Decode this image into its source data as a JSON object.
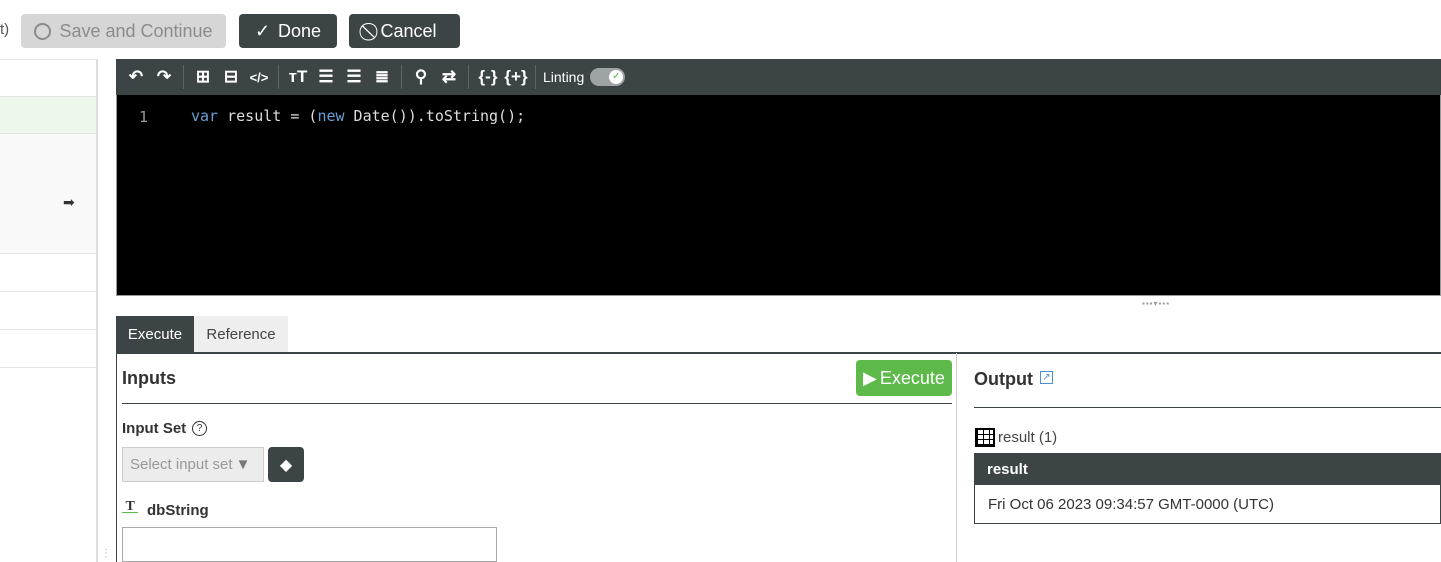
{
  "top": {
    "fragment": "t)",
    "save_label": "Save and Continue",
    "done_label": "Done",
    "cancel_label": "Cancel"
  },
  "editor": {
    "linting_label": "Linting",
    "line_number": "1",
    "code": {
      "kw1": "var",
      "p1": " result = (",
      "kw2": "new",
      "p2": " Date()).toString();"
    }
  },
  "tabs": [
    {
      "label": "Execute"
    },
    {
      "label": "Reference"
    }
  ],
  "inputs": {
    "title": "Inputs",
    "execute_label": "Execute",
    "input_set_label": "Input Set",
    "select_placeholder": "Select input set",
    "param_label": "dbString",
    "param_value": ""
  },
  "output": {
    "title": "Output",
    "result_label": "result (1)",
    "table": {
      "header": "result",
      "rows": [
        "Fri Oct 06 2023 09:34:57 GMT-0000 (UTC)"
      ]
    }
  },
  "colors": {
    "dark": "#3c4446",
    "green": "#5cb94a"
  }
}
